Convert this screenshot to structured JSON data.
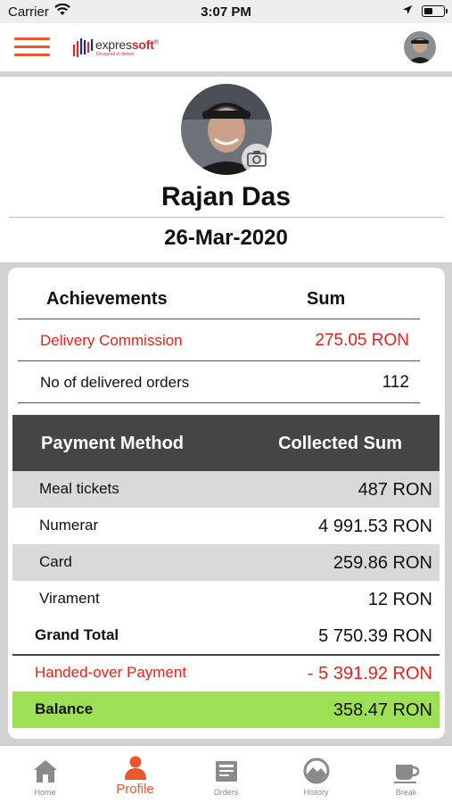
{
  "status_bar": {
    "carrier": "Carrier",
    "time": "3:07 PM",
    "battery_level": 0.45
  },
  "nav": {
    "brand_prefix": "expres",
    "brand_suffix": "soft",
    "brand_mark": "®",
    "tagline": "Designed to deliver.",
    "menu_icon": "hamburger-icon",
    "avatar_icon": "user-avatar"
  },
  "profile": {
    "name": "Rajan Das",
    "date": "26-Mar-2020",
    "camera_icon": "camera-icon"
  },
  "achievements": {
    "header": {
      "col1": "Achievements",
      "col2": "Sum"
    },
    "rows": [
      {
        "label": "Delivery Commission",
        "value": "275.05 RON",
        "color": "#e3221b"
      },
      {
        "label": "No of delivered orders",
        "value": "112"
      }
    ]
  },
  "payments": {
    "header": {
      "col1": "Payment Method",
      "col2": "Collected Sum"
    },
    "rows": [
      {
        "label": "Meal tickets",
        "value": "487 RON"
      },
      {
        "label": "Numerar",
        "value": "4 991.53 RON"
      },
      {
        "label": "Card",
        "value": "259.86 RON"
      },
      {
        "label": "Virament",
        "value": "12 RON"
      }
    ],
    "grand_total": {
      "label": "Grand Total",
      "value": "5 750.39 RON"
    },
    "handed_over": {
      "label": "Handed-over Payment",
      "value": "- 5 391.92 RON",
      "color": "#e3221b"
    },
    "balance": {
      "label": "Balance",
      "value": "358.47 RON",
      "color": "#9ee055"
    }
  },
  "tabs": [
    {
      "label": "Home",
      "icon": "home-icon"
    },
    {
      "label": "Profile",
      "icon": "profile-icon",
      "active": true
    },
    {
      "label": "Orders",
      "icon": "orders-icon"
    },
    {
      "label": "History",
      "icon": "history-icon"
    },
    {
      "label": "Break",
      "icon": "coffee-cup-icon"
    }
  ],
  "colors": {
    "accent": "#e8582a",
    "negative": "#e3221b",
    "balance": "#9ee055",
    "table_header": "#454545"
  }
}
